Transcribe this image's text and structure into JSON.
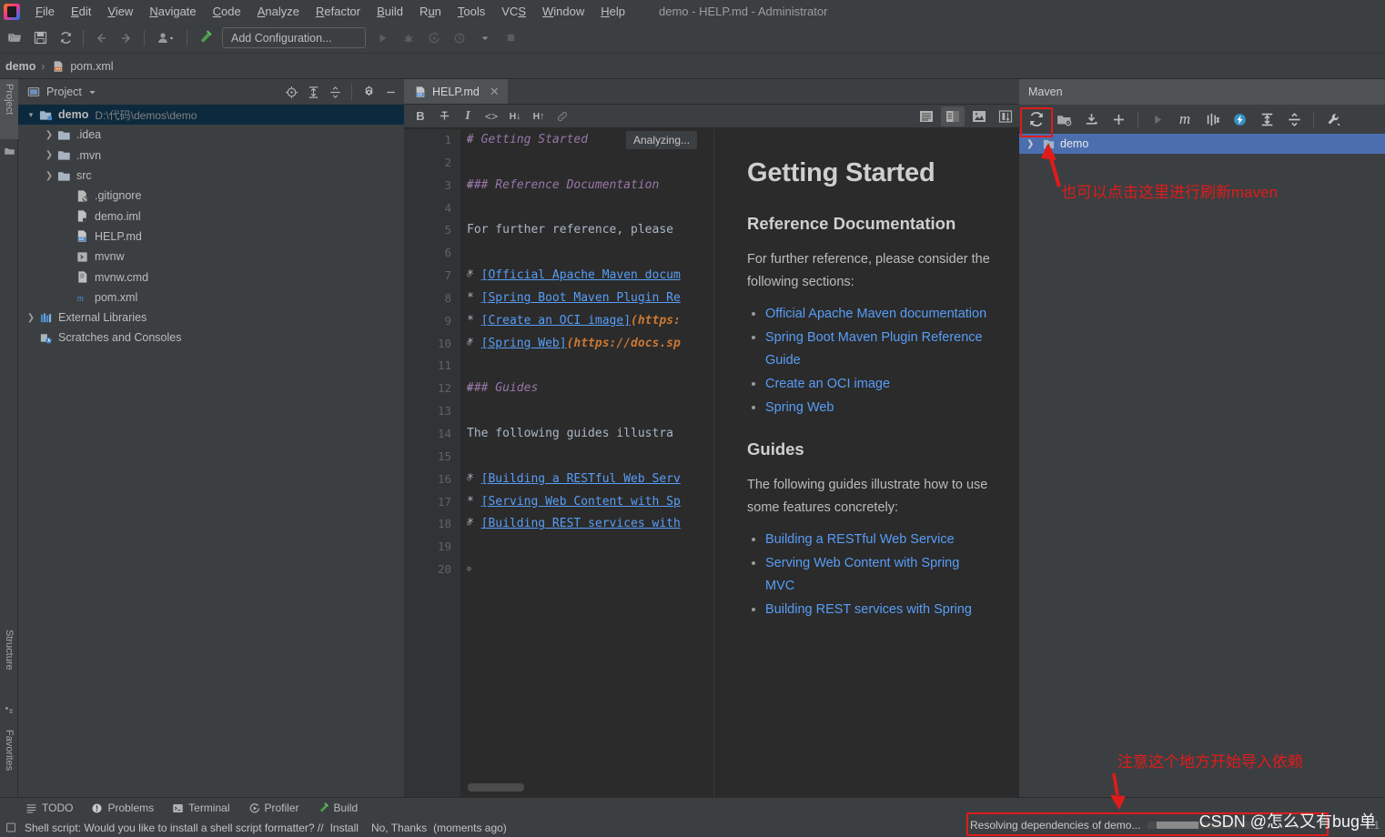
{
  "window": {
    "title": "demo - HELP.md - Administrator",
    "logo_icon": "intellij-idea-logo-icon"
  },
  "menubar": {
    "items": [
      {
        "label": "File",
        "mnemonic": "F"
      },
      {
        "label": "Edit",
        "mnemonic": "E"
      },
      {
        "label": "View",
        "mnemonic": "V"
      },
      {
        "label": "Navigate",
        "mnemonic": "N"
      },
      {
        "label": "Code",
        "mnemonic": "C"
      },
      {
        "label": "Analyze",
        "mnemonic": "A"
      },
      {
        "label": "Refactor",
        "mnemonic": "R"
      },
      {
        "label": "Build",
        "mnemonic": "B"
      },
      {
        "label": "Run",
        "mnemonic": "u"
      },
      {
        "label": "Tools",
        "mnemonic": "T"
      },
      {
        "label": "VCS",
        "mnemonic": "S"
      },
      {
        "label": "Window",
        "mnemonic": "W"
      },
      {
        "label": "Help",
        "mnemonic": "H"
      }
    ]
  },
  "toolbar": {
    "open_icon": "open-folder-icon",
    "save_icon": "save-icon",
    "sync_icon": "sync-refresh-icon",
    "back_icon": "arrow-left-icon",
    "forward_icon": "arrow-right-icon",
    "profile_icon": "user-profile-icon",
    "build_icon": "hammer-build-icon",
    "run_config_label": "Add Configuration...",
    "run_icon": "run-play-icon",
    "debug_icon": "debug-bug-icon",
    "coverage_icon": "run-coverage-icon",
    "profile_run_icon": "profiler-icon",
    "stop_icon": "stop-square-icon"
  },
  "navbar": {
    "crumbs": [
      "demo",
      "pom.xml"
    ],
    "separator": "›",
    "file_icon": "pom-xml-file-icon"
  },
  "left_rail": {
    "tabs": [
      {
        "label": "Project",
        "icon": "project-icon",
        "selected": true
      },
      {
        "label": "Structure",
        "icon": "structure-icon",
        "selected": false
      },
      {
        "label": "Favorites",
        "icon": "favorites-star-icon",
        "selected": false
      }
    ]
  },
  "project_panel": {
    "title": "Project",
    "title_icon": "project-panel-icon",
    "dropdown_icon": "chevron-down-icon",
    "header_icons": [
      {
        "name": "locate-target-icon"
      },
      {
        "name": "expand-all-icon"
      },
      {
        "name": "collapse-all-icon"
      },
      {
        "name": "gear-settings-icon"
      },
      {
        "name": "minimize-icon"
      }
    ],
    "tree": [
      {
        "indent": 0,
        "arrow": "⌄",
        "icon": "module-folder-icon",
        "label": "demo",
        "path": "D:\\代码\\demos\\demo",
        "bold": true,
        "selected": true
      },
      {
        "indent": 1,
        "arrow": "›",
        "icon": "folder-icon",
        "label": ".idea",
        "path": "",
        "bold": false,
        "selected": false
      },
      {
        "indent": 1,
        "arrow": "›",
        "icon": "folder-icon",
        "label": ".mvn",
        "path": "",
        "bold": false,
        "selected": false
      },
      {
        "indent": 1,
        "arrow": "›",
        "icon": "folder-icon",
        "label": "src",
        "path": "",
        "bold": false,
        "selected": false
      },
      {
        "indent": 2,
        "arrow": "",
        "icon": "gitignore-file-icon",
        "label": ".gitignore",
        "path": "",
        "bold": false,
        "selected": false
      },
      {
        "indent": 2,
        "arrow": "",
        "icon": "iml-file-icon",
        "label": "demo.iml",
        "path": "",
        "bold": false,
        "selected": false
      },
      {
        "indent": 2,
        "arrow": "",
        "icon": "markdown-file-icon",
        "label": "HELP.md",
        "path": "",
        "bold": false,
        "selected": false
      },
      {
        "indent": 2,
        "arrow": "",
        "icon": "script-file-icon",
        "label": "mvnw",
        "path": "",
        "bold": false,
        "selected": false
      },
      {
        "indent": 2,
        "arrow": "",
        "icon": "cmd-file-icon",
        "label": "mvnw.cmd",
        "path": "",
        "bold": false,
        "selected": false
      },
      {
        "indent": 2,
        "arrow": "",
        "icon": "maven-pom-icon",
        "label": "pom.xml",
        "path": "",
        "bold": false,
        "selected": false
      },
      {
        "indent": 0,
        "arrow": "›",
        "icon": "external-libraries-icon",
        "label": "External Libraries",
        "path": "",
        "bold": false,
        "selected": false
      },
      {
        "indent": 0,
        "arrow": "",
        "icon": "scratches-icon",
        "label": "Scratches and Consoles",
        "path": "",
        "bold": false,
        "selected": false
      }
    ]
  },
  "editor": {
    "tab": {
      "label": "HELP.md",
      "icon": "markdown-file-icon",
      "close_icon": "close-icon"
    },
    "md_toolbar": [
      {
        "name": "bold-button",
        "glyph": "B"
      },
      {
        "name": "strikethrough-button",
        "glyph": "S"
      },
      {
        "name": "italic-button",
        "glyph": "I"
      },
      {
        "name": "code-button",
        "glyph": "<>"
      },
      {
        "name": "heading-down-button",
        "glyph": "H↓"
      },
      {
        "name": "heading-up-button",
        "glyph": "H↑"
      },
      {
        "name": "link-button",
        "glyph": "ὑ7"
      }
    ],
    "view_toggles": [
      {
        "name": "show-editor-only-toggle",
        "active": false
      },
      {
        "name": "show-editor-and-preview-toggle",
        "active": true
      },
      {
        "name": "show-preview-only-toggle",
        "active": false
      },
      {
        "name": "split-layout-toggle",
        "active": false
      }
    ],
    "inspection_tooltip": "Analyzing...",
    "lines": [
      {
        "n": 1,
        "fold": "⊖",
        "segments": [
          {
            "cls": "c-head",
            "t": "# Getting Started"
          }
        ]
      },
      {
        "n": 2,
        "fold": "",
        "segments": []
      },
      {
        "n": 3,
        "fold": "⊖",
        "segments": [
          {
            "cls": "c-head",
            "t": "### Reference Documentation"
          }
        ]
      },
      {
        "n": 4,
        "fold": "",
        "segments": []
      },
      {
        "n": 5,
        "fold": "",
        "segments": [
          {
            "cls": "c-text",
            "t": "For further reference, please"
          }
        ]
      },
      {
        "n": 6,
        "fold": "",
        "segments": []
      },
      {
        "n": 7,
        "fold": "⊖",
        "segments": [
          {
            "cls": "c-bullet",
            "t": "* "
          },
          {
            "cls": "c-link",
            "t": "[Official Apache Maven docum"
          }
        ]
      },
      {
        "n": 8,
        "fold": "",
        "segments": [
          {
            "cls": "c-bullet",
            "t": "* "
          },
          {
            "cls": "c-link",
            "t": "[Spring Boot Maven Plugin Re"
          }
        ]
      },
      {
        "n": 9,
        "fold": "",
        "segments": [
          {
            "cls": "c-bullet",
            "t": "* "
          },
          {
            "cls": "c-link",
            "t": "[Create an OCI image]"
          },
          {
            "cls": "c-url",
            "t": "(https:"
          }
        ]
      },
      {
        "n": 10,
        "fold": "⊕",
        "segments": [
          {
            "cls": "c-bullet",
            "t": "* "
          },
          {
            "cls": "c-link",
            "t": "[Spring Web]"
          },
          {
            "cls": "c-url",
            "t": "(https://docs.sp"
          }
        ]
      },
      {
        "n": 11,
        "fold": "",
        "segments": []
      },
      {
        "n": 12,
        "fold": "⊖",
        "segments": [
          {
            "cls": "c-head",
            "t": "### Guides"
          }
        ]
      },
      {
        "n": 13,
        "fold": "",
        "segments": []
      },
      {
        "n": 14,
        "fold": "",
        "segments": [
          {
            "cls": "c-text",
            "t": "The following guides illustra"
          }
        ]
      },
      {
        "n": 15,
        "fold": "",
        "segments": []
      },
      {
        "n": 16,
        "fold": "⊖",
        "segments": [
          {
            "cls": "c-bullet",
            "t": "* "
          },
          {
            "cls": "c-link",
            "t": "[Building a RESTful Web Serv"
          }
        ]
      },
      {
        "n": 17,
        "fold": "",
        "segments": [
          {
            "cls": "c-bullet",
            "t": "* "
          },
          {
            "cls": "c-link",
            "t": "[Serving Web Content with Sp"
          }
        ]
      },
      {
        "n": 18,
        "fold": "⊕",
        "segments": [
          {
            "cls": "c-bullet",
            "t": "* "
          },
          {
            "cls": "c-link",
            "t": "[Building REST services with"
          }
        ]
      },
      {
        "n": 19,
        "fold": "",
        "segments": []
      },
      {
        "n": 20,
        "fold": "⊕",
        "segments": []
      }
    ]
  },
  "preview": {
    "h1": "Getting Started",
    "section1_heading": "Reference Documentation",
    "section1_text": "For further reference, please consider the following sections:",
    "section1_links": [
      "Official Apache Maven documentation",
      "Spring Boot Maven Plugin Reference Guide",
      "Create an OCI image",
      "Spring Web"
    ],
    "section2_heading": "Guides",
    "section2_text": "The following guides illustrate how to use some features concretely:",
    "section2_links": [
      "Building a RESTful Web Service",
      "Serving Web Content with Spring MVC",
      "Building REST services with Spring"
    ]
  },
  "maven_panel": {
    "title": "Maven",
    "toolbar": [
      {
        "name": "reload-all-maven-projects-button",
        "glyph": "refresh"
      },
      {
        "name": "generate-sources-button",
        "glyph": "folder-g"
      },
      {
        "name": "download-sources-button",
        "glyph": "download"
      },
      {
        "name": "add-maven-project-button",
        "glyph": "plus"
      },
      {
        "name": "run-maven-build-button",
        "glyph": "play"
      },
      {
        "name": "execute-maven-goal-button",
        "glyph": "m"
      },
      {
        "name": "toggle-skip-tests-button",
        "glyph": "skip-tests"
      },
      {
        "name": "toggle-offline-mode-button",
        "glyph": "offline"
      },
      {
        "name": "expand-all-button",
        "glyph": "expand"
      },
      {
        "name": "collapse-all-button",
        "glyph": "collapse"
      },
      {
        "name": "maven-settings-button",
        "glyph": "wrench"
      }
    ],
    "tree": [
      {
        "arrow": "›",
        "icon": "maven-project-icon",
        "label": "demo",
        "selected": true
      }
    ]
  },
  "annotations": {
    "maven_refresh_note": "也可以点击这里进行刷新maven",
    "status_note": "注意这个地方开始导入依赖",
    "color": "#e01b1b"
  },
  "bottom_tools": [
    {
      "label": "TODO",
      "icon": "todo-list-icon"
    },
    {
      "label": "Problems",
      "icon": "problems-warning-icon"
    },
    {
      "label": "Terminal",
      "icon": "terminal-icon"
    },
    {
      "label": "Profiler",
      "icon": "profiler-icon"
    },
    {
      "label": "Build",
      "icon": "hammer-build-icon"
    }
  ],
  "status_bar": {
    "event_icon": "event-log-icon",
    "message": "Shell script: Would you like to install a shell script formatter? //",
    "action_install": "Install",
    "action_dismiss": "No, Thanks",
    "timestamp": "(moments ago)",
    "progress_text": "Resolving dependencies of demo...",
    "caret_position": "1:1"
  },
  "watermark": {
    "text": "CSDN @怎么又有bug单"
  },
  "colors": {
    "panel_bg": "#3c3f41",
    "editor_bg": "#2b2b2b",
    "gutter_bg": "#313335",
    "tree_selection": "#0d293e",
    "maven_selection": "#4b6eaf",
    "link_blue": "#589df6",
    "annotation_red": "#e01b1b",
    "heading_purple": "#9876aa",
    "url_orange": "#cc7832"
  }
}
